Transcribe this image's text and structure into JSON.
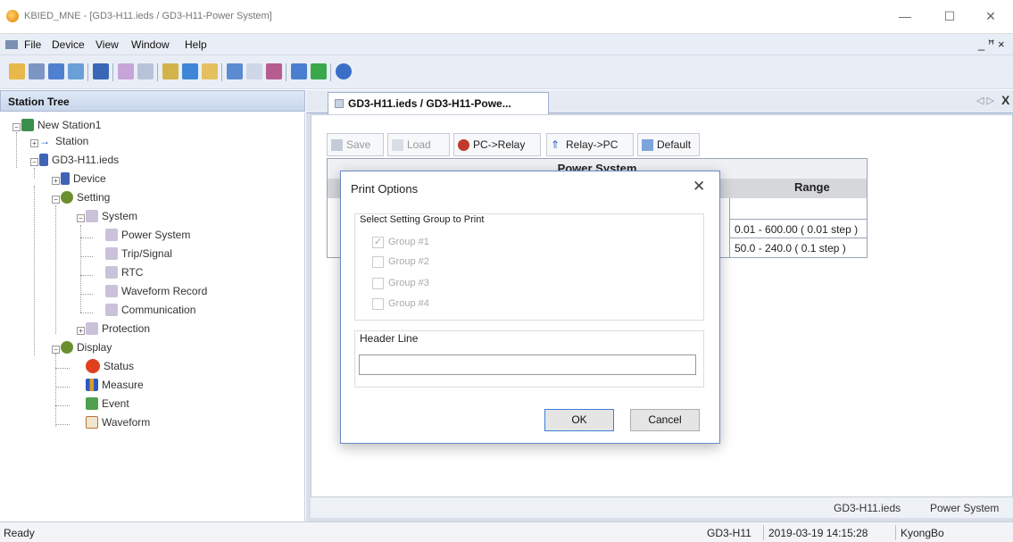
{
  "window": {
    "title": "KBIED_MNE - [GD3-H11.ieds / GD3-H11-Power System]",
    "minimize": "—",
    "maximize": "☐",
    "close": "✕"
  },
  "menu": {
    "items": [
      "File",
      "Device",
      "View",
      "Window",
      "Help"
    ],
    "mdi_controls": "_ ꟸ ×"
  },
  "station_tree": {
    "header": "Station Tree",
    "nodes": {
      "root": "New Station1",
      "station": "Station",
      "ieds": "GD3-H11.ieds",
      "device": "Device",
      "setting": "Setting",
      "system": "System",
      "power_system": "Power System",
      "trip_signal": "Trip/Signal",
      "rtc": "RTC",
      "waveform_record": "Waveform Record",
      "communication": "Communication",
      "protection": "Protection",
      "display": "Display",
      "status": "Status",
      "measure": "Measure",
      "event": "Event",
      "waveform": "Waveform"
    }
  },
  "doc": {
    "tab_label": "GD3-H11.ieds / GD3-H11-Powe...",
    "tab_nav": "◁ ▷",
    "tab_close": "X",
    "buttons": {
      "save": "Save",
      "load": "Load",
      "pc_relay": "PC->Relay",
      "relay_pc": "Relay->PC",
      "default": "Default"
    },
    "table_title": "Power System",
    "range_header": "Range",
    "range_rows": [
      "0.01 - 600.00 ( 0.01 step )",
      "50.0 - 240.0 ( 0.1 step )"
    ],
    "status_file": "GD3-H11.ieds",
    "status_page": "Power System"
  },
  "dialog": {
    "title": "Print Options",
    "close": "✕",
    "group_label": "Select Setting Group to Print",
    "groups": [
      {
        "label": "Group #1",
        "checked": true
      },
      {
        "label": "Group #2",
        "checked": false
      },
      {
        "label": "Group #3",
        "checked": false
      },
      {
        "label": "Group #4",
        "checked": false
      }
    ],
    "header_label": "Header Line",
    "header_value": "",
    "ok": "OK",
    "cancel": "Cancel"
  },
  "statusbar": {
    "left": "Ready",
    "device": "GD3-H11",
    "datetime": "2019-03-19 14:15:28",
    "user": "KyongBo"
  },
  "colors": {
    "accent": "#3c7fd6",
    "panel": "#e9eef6"
  }
}
